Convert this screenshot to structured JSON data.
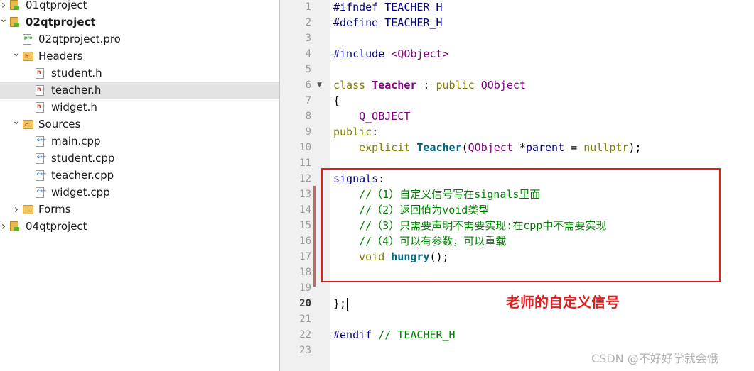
{
  "tree": {
    "items": [
      {
        "label": "01qtproject",
        "level": 0,
        "expanded": false,
        "icon": "project-icon",
        "bold": false,
        "selected": false
      },
      {
        "label": "02qtproject",
        "level": 0,
        "expanded": true,
        "icon": "project-icon",
        "bold": true,
        "selected": false
      },
      {
        "label": "02qtproject.pro",
        "level": 1,
        "expanded": null,
        "icon": "pro-file-icon",
        "bold": false,
        "selected": false
      },
      {
        "label": "Headers",
        "level": 1,
        "expanded": true,
        "icon": "headers-folder-icon",
        "bold": false,
        "selected": false
      },
      {
        "label": "student.h",
        "level": 2,
        "expanded": null,
        "icon": "header-file-icon",
        "bold": false,
        "selected": false
      },
      {
        "label": "teacher.h",
        "level": 2,
        "expanded": null,
        "icon": "header-file-icon",
        "bold": false,
        "selected": true
      },
      {
        "label": "widget.h",
        "level": 2,
        "expanded": null,
        "icon": "header-file-icon",
        "bold": false,
        "selected": false
      },
      {
        "label": "Sources",
        "level": 1,
        "expanded": true,
        "icon": "sources-folder-icon",
        "bold": false,
        "selected": false
      },
      {
        "label": "main.cpp",
        "level": 2,
        "expanded": null,
        "icon": "cpp-file-icon",
        "bold": false,
        "selected": false
      },
      {
        "label": "student.cpp",
        "level": 2,
        "expanded": null,
        "icon": "cpp-file-icon",
        "bold": false,
        "selected": false
      },
      {
        "label": "teacher.cpp",
        "level": 2,
        "expanded": null,
        "icon": "cpp-file-icon",
        "bold": false,
        "selected": false
      },
      {
        "label": "widget.cpp",
        "level": 2,
        "expanded": null,
        "icon": "cpp-file-icon",
        "bold": false,
        "selected": false
      },
      {
        "label": "Forms",
        "level": 1,
        "expanded": false,
        "icon": "forms-folder-icon",
        "bold": false,
        "selected": false
      },
      {
        "label": "04qtproject",
        "level": 0,
        "expanded": false,
        "icon": "project-icon",
        "bold": false,
        "selected": false
      }
    ]
  },
  "editor": {
    "current_line": 20,
    "fold_marker_lines": [
      6
    ],
    "lines": [
      {
        "n": "1",
        "tokens": [
          [
            "pp",
            "#ifndef TEACHER_H"
          ]
        ]
      },
      {
        "n": "2",
        "tokens": [
          [
            "pp",
            "#define TEACHER_H"
          ]
        ]
      },
      {
        "n": "3",
        "tokens": []
      },
      {
        "n": "4",
        "tokens": [
          [
            "pp",
            "#include "
          ],
          [
            "str",
            "<QObject>"
          ]
        ]
      },
      {
        "n": "5",
        "tokens": []
      },
      {
        "n": "6",
        "tokens": [
          [
            "kw",
            "class "
          ],
          [
            "tyb",
            "Teacher"
          ],
          [
            "p",
            " : "
          ],
          [
            "kw",
            "public "
          ],
          [
            "ty",
            "QObject"
          ]
        ]
      },
      {
        "n": "7",
        "tokens": [
          [
            "p",
            "{"
          ]
        ]
      },
      {
        "n": "8",
        "tokens": [
          [
            "p",
            "    "
          ],
          [
            "ty",
            "Q_OBJECT"
          ]
        ]
      },
      {
        "n": "9",
        "tokens": [
          [
            "kw",
            "public"
          ],
          [
            "p",
            ":"
          ]
        ]
      },
      {
        "n": "10",
        "tokens": [
          [
            "p",
            "    "
          ],
          [
            "kw",
            "explicit "
          ],
          [
            "fn",
            "Teacher"
          ],
          [
            "p",
            "("
          ],
          [
            "ty",
            "QObject "
          ],
          [
            "p",
            "*"
          ],
          [
            "nv",
            "parent"
          ],
          [
            "p",
            " = "
          ],
          [
            "kw",
            "nullptr"
          ],
          [
            "p",
            ");"
          ]
        ]
      },
      {
        "n": "11",
        "tokens": []
      },
      {
        "n": "12",
        "tokens": [
          [
            "nv",
            "signals"
          ],
          [
            "p",
            ":"
          ]
        ]
      },
      {
        "n": "13",
        "tokens": [
          [
            "p",
            "    "
          ],
          [
            "cm",
            "//（1）自定义信号写在signals里面"
          ]
        ]
      },
      {
        "n": "14",
        "tokens": [
          [
            "p",
            "    "
          ],
          [
            "cm",
            "//（2）返回值为void类型"
          ]
        ]
      },
      {
        "n": "15",
        "tokens": [
          [
            "p",
            "    "
          ],
          [
            "cm",
            "//（3）只需要声明不需要实现:在cpp中不需要实现"
          ]
        ]
      },
      {
        "n": "16",
        "tokens": [
          [
            "p",
            "    "
          ],
          [
            "cm",
            "//（4）可以有参数，可以重载"
          ]
        ]
      },
      {
        "n": "17",
        "tokens": [
          [
            "p",
            "    "
          ],
          [
            "kw",
            "void "
          ],
          [
            "fn",
            "hungry"
          ],
          [
            "p",
            "();"
          ]
        ]
      },
      {
        "n": "18",
        "tokens": []
      },
      {
        "n": "19",
        "tokens": []
      },
      {
        "n": "20",
        "tokens": [
          [
            "p",
            "};"
          ]
        ],
        "cursor": true
      },
      {
        "n": "21",
        "tokens": []
      },
      {
        "n": "22",
        "tokens": [
          [
            "pp",
            "#endif "
          ],
          [
            "cm",
            "// TEACHER_H"
          ]
        ]
      },
      {
        "n": "23",
        "tokens": []
      }
    ]
  },
  "annotation": {
    "label": "老师的自定义信号",
    "color": "#e02020"
  },
  "watermark": {
    "text": "CSDN @不好好学就会饿"
  },
  "colors": {
    "keyword": "#808000",
    "type": "#800080",
    "comment": "#008000",
    "preprocessor": "#000080",
    "highlight_box": "#e02020",
    "selection": "#e3e3e3",
    "gutter": "#f0f0f0"
  }
}
